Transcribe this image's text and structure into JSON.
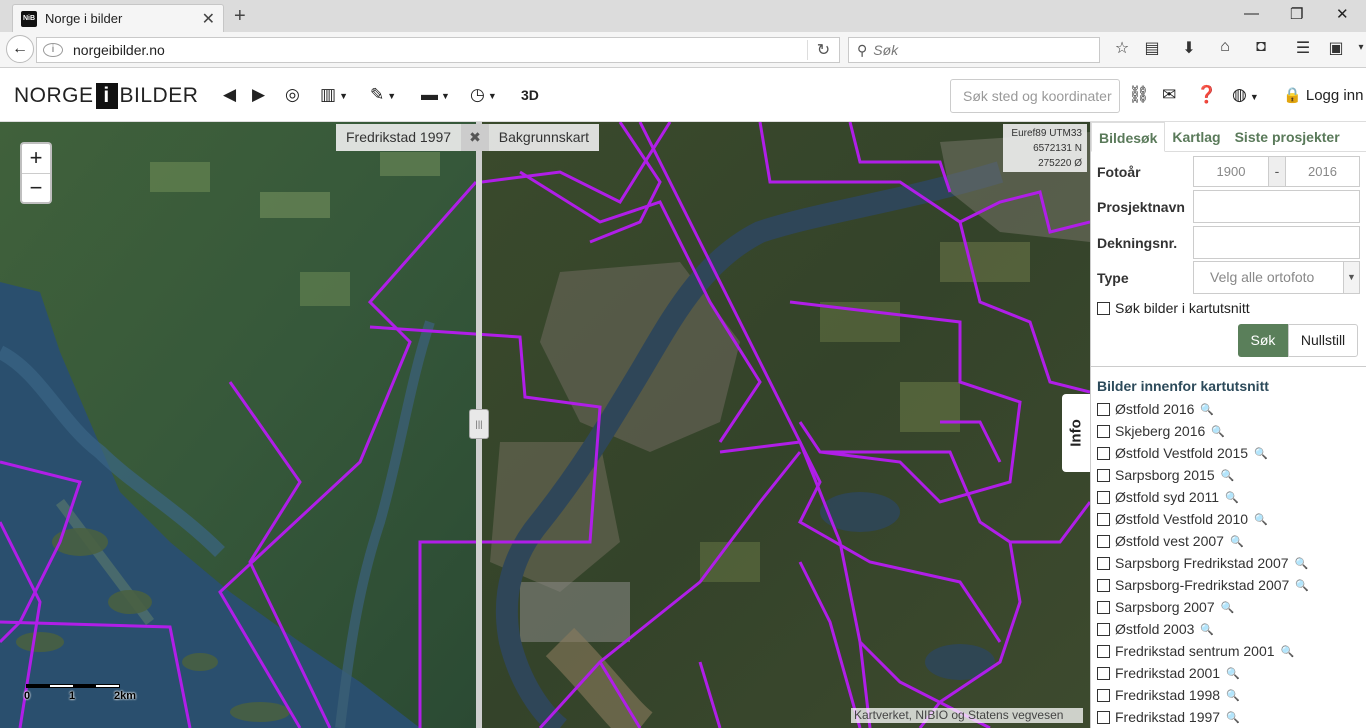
{
  "browser": {
    "tab_title": "Norge i bilder",
    "favicon_text": "NiB",
    "url": "norgeibilder.no",
    "search_placeholder": "Søk"
  },
  "app": {
    "logo_left": "NORGE",
    "logo_mid": "i",
    "logo_right": "BILDER",
    "tool_3d": "3D",
    "place_search_placeholder": "Søk sted og koordinater",
    "login_label": "Logg inn"
  },
  "map": {
    "swipe_left_label": "Fredrikstad 1997",
    "swipe_close": "✖",
    "swipe_right_label": "Bakgrunnskart",
    "coord_system": "Euref89 UTM33",
    "coord_north": "6572131 N",
    "coord_east": "275220 Ø",
    "zoom_in": "+",
    "zoom_out": "−",
    "info_tab": "Info",
    "attribution": "Kartverket, NIBIO og Statens vegvesen",
    "scale_labels": [
      "0",
      "1",
      "2km"
    ]
  },
  "sidebar": {
    "tabs": [
      {
        "label": "Bildesøk",
        "active": true
      },
      {
        "label": "Kartlag",
        "active": false
      },
      {
        "label": "Siste prosjekter",
        "active": false
      }
    ],
    "fotoar_label": "Fotoår",
    "year_from": "1900",
    "year_sep": "-",
    "year_to": "2016",
    "prosjektnavn_label": "Prosjektnavn",
    "dekningsnr_label": "Dekningsnr.",
    "type_label": "Type",
    "type_value": "Velg alle ortofoto",
    "chk_kartutsnitt": "Søk bilder i kartutsnitt",
    "btn_sok": "Søk",
    "btn_nullstill": "Nullstill",
    "list_heading": "Bilder innenfor kartutsnitt",
    "projects": [
      "Østfold 2016",
      "Skjeberg 2016",
      "Østfold Vestfold 2015",
      "Sarpsborg 2015",
      "Østfold syd 2011",
      "Østfold Vestfold 2010",
      "Østfold vest 2007",
      "Sarpsborg Fredrikstad 2007",
      "Sarpsborg-Fredrikstad 2007",
      "Sarpsborg 2007",
      "Østfold 2003",
      "Fredrikstad sentrum 2001",
      "Fredrikstad 2001",
      "Fredrikstad 1998",
      "Fredrikstad 1997"
    ]
  },
  "colors": {
    "accent": "#5a7f5a",
    "coverage_outline": "#b01ee8",
    "water": "#2a4f6e"
  }
}
